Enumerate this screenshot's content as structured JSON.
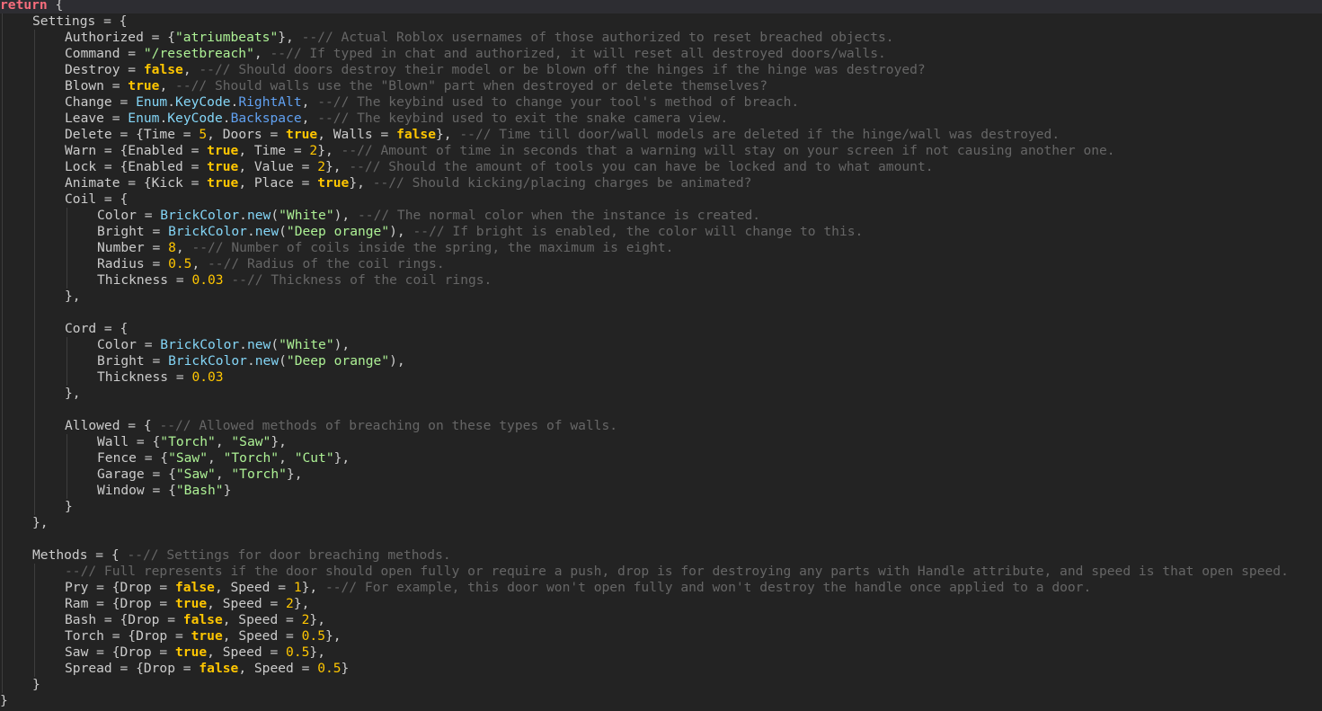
{
  "editor": {
    "colors": {
      "background": "#232323",
      "text": "#cccccc",
      "keyword": "#f86d7c",
      "string": "#adf195",
      "comment": "#666666",
      "number": "#ffc600",
      "builtin": "#84d6f7",
      "property": "#61a1f1",
      "current_line": "#2d2d32"
    },
    "lines": [
      {
        "indent": 0,
        "current": true,
        "tokens": [
          {
            "t": "return",
            "c": "kw-ret"
          },
          {
            "t": " {",
            "c": "id"
          }
        ]
      },
      {
        "indent": 1,
        "tokens": [
          {
            "t": "Settings = {",
            "c": "id"
          }
        ]
      },
      {
        "indent": 2,
        "tokens": [
          {
            "t": "Authorized = {",
            "c": "id"
          },
          {
            "t": "\"atriumbeats\"",
            "c": "str"
          },
          {
            "t": "}, ",
            "c": "id"
          },
          {
            "t": "--// Actual Roblox usernames of those authorized to reset breached objects.",
            "c": "cmt"
          }
        ]
      },
      {
        "indent": 2,
        "tokens": [
          {
            "t": "Command = ",
            "c": "id"
          },
          {
            "t": "\"/resetbreach\"",
            "c": "str"
          },
          {
            "t": ", ",
            "c": "id"
          },
          {
            "t": "--// If typed in chat and authorized, it will reset all destroyed doors/walls.",
            "c": "cmt"
          }
        ]
      },
      {
        "indent": 2,
        "tokens": [
          {
            "t": "Destroy = ",
            "c": "id"
          },
          {
            "t": "false",
            "c": "bool"
          },
          {
            "t": ", ",
            "c": "id"
          },
          {
            "t": "--// Should doors destroy their model or be blown off the hinges if the hinge was destroyed?",
            "c": "cmt"
          }
        ]
      },
      {
        "indent": 2,
        "tokens": [
          {
            "t": "Blown = ",
            "c": "id"
          },
          {
            "t": "true",
            "c": "bool"
          },
          {
            "t": ", ",
            "c": "id"
          },
          {
            "t": "--// Should walls use the \"Blown\" part when destroyed or delete themselves?",
            "c": "cmt"
          }
        ]
      },
      {
        "indent": 2,
        "tokens": [
          {
            "t": "Change = ",
            "c": "id"
          },
          {
            "t": "Enum",
            "c": "builtin"
          },
          {
            "t": ".",
            "c": "id"
          },
          {
            "t": "KeyCode",
            "c": "builtin"
          },
          {
            "t": ".",
            "c": "id"
          },
          {
            "t": "RightAlt",
            "c": "prop"
          },
          {
            "t": ", ",
            "c": "id"
          },
          {
            "t": "--// The keybind used to change your tool's method of breach.",
            "c": "cmt"
          }
        ]
      },
      {
        "indent": 2,
        "tokens": [
          {
            "t": "Leave = ",
            "c": "id"
          },
          {
            "t": "Enum",
            "c": "builtin"
          },
          {
            "t": ".",
            "c": "id"
          },
          {
            "t": "KeyCode",
            "c": "builtin"
          },
          {
            "t": ".",
            "c": "id"
          },
          {
            "t": "Backspace",
            "c": "prop"
          },
          {
            "t": ", ",
            "c": "id"
          },
          {
            "t": "--// The keybind used to exit the snake camera view.",
            "c": "cmt"
          }
        ]
      },
      {
        "indent": 2,
        "tokens": [
          {
            "t": "Delete = {Time = ",
            "c": "id"
          },
          {
            "t": "5",
            "c": "num"
          },
          {
            "t": ", Doors = ",
            "c": "id"
          },
          {
            "t": "true",
            "c": "bool"
          },
          {
            "t": ", Walls = ",
            "c": "id"
          },
          {
            "t": "false",
            "c": "bool"
          },
          {
            "t": "}, ",
            "c": "id"
          },
          {
            "t": "--// Time till door/wall models are deleted if the hinge/wall was destroyed.",
            "c": "cmt"
          }
        ]
      },
      {
        "indent": 2,
        "tokens": [
          {
            "t": "Warn = {Enabled = ",
            "c": "id"
          },
          {
            "t": "true",
            "c": "bool"
          },
          {
            "t": ", Time = ",
            "c": "id"
          },
          {
            "t": "2",
            "c": "num"
          },
          {
            "t": "}, ",
            "c": "id"
          },
          {
            "t": "--// Amount of time in seconds that a warning will stay on your screen if not causing another one.",
            "c": "cmt"
          }
        ]
      },
      {
        "indent": 2,
        "tokens": [
          {
            "t": "Lock = {Enabled = ",
            "c": "id"
          },
          {
            "t": "true",
            "c": "bool"
          },
          {
            "t": ", Value = ",
            "c": "id"
          },
          {
            "t": "2",
            "c": "num"
          },
          {
            "t": "}, ",
            "c": "id"
          },
          {
            "t": "--// Should the amount of tools you can have be locked and to what amount.",
            "c": "cmt"
          }
        ]
      },
      {
        "indent": 2,
        "tokens": [
          {
            "t": "Animate = {Kick = ",
            "c": "id"
          },
          {
            "t": "true",
            "c": "bool"
          },
          {
            "t": ", Place = ",
            "c": "id"
          },
          {
            "t": "true",
            "c": "bool"
          },
          {
            "t": "}, ",
            "c": "id"
          },
          {
            "t": "--// Should kicking/placing charges be animated?",
            "c": "cmt"
          }
        ]
      },
      {
        "indent": 2,
        "tokens": [
          {
            "t": "Coil = {",
            "c": "id"
          }
        ]
      },
      {
        "indent": 3,
        "tokens": [
          {
            "t": "Color = ",
            "c": "id"
          },
          {
            "t": "BrickColor",
            "c": "builtin"
          },
          {
            "t": ".",
            "c": "id"
          },
          {
            "t": "new",
            "c": "builtin"
          },
          {
            "t": "(",
            "c": "id"
          },
          {
            "t": "\"White\"",
            "c": "str"
          },
          {
            "t": "), ",
            "c": "id"
          },
          {
            "t": "--// The normal color when the instance is created.",
            "c": "cmt"
          }
        ]
      },
      {
        "indent": 3,
        "tokens": [
          {
            "t": "Bright = ",
            "c": "id"
          },
          {
            "t": "BrickColor",
            "c": "builtin"
          },
          {
            "t": ".",
            "c": "id"
          },
          {
            "t": "new",
            "c": "builtin"
          },
          {
            "t": "(",
            "c": "id"
          },
          {
            "t": "\"Deep orange\"",
            "c": "str"
          },
          {
            "t": "), ",
            "c": "id"
          },
          {
            "t": "--// If bright is enabled, the color will change to this.",
            "c": "cmt"
          }
        ]
      },
      {
        "indent": 3,
        "tokens": [
          {
            "t": "Number = ",
            "c": "id"
          },
          {
            "t": "8",
            "c": "num"
          },
          {
            "t": ", ",
            "c": "id"
          },
          {
            "t": "--// Number of coils inside the spring, the maximum is eight.",
            "c": "cmt"
          }
        ]
      },
      {
        "indent": 3,
        "tokens": [
          {
            "t": "Radius = ",
            "c": "id"
          },
          {
            "t": "0.5",
            "c": "num"
          },
          {
            "t": ", ",
            "c": "id"
          },
          {
            "t": "--// Radius of the coil rings.",
            "c": "cmt"
          }
        ]
      },
      {
        "indent": 3,
        "tokens": [
          {
            "t": "Thickness = ",
            "c": "id"
          },
          {
            "t": "0.03",
            "c": "num"
          },
          {
            "t": " ",
            "c": "id"
          },
          {
            "t": "--// Thickness of the coil rings.",
            "c": "cmt"
          }
        ]
      },
      {
        "indent": 2,
        "tokens": [
          {
            "t": "},",
            "c": "id"
          }
        ]
      },
      {
        "indent": 2,
        "tokens": []
      },
      {
        "indent": 2,
        "tokens": [
          {
            "t": "Cord = {",
            "c": "id"
          }
        ]
      },
      {
        "indent": 3,
        "tokens": [
          {
            "t": "Color = ",
            "c": "id"
          },
          {
            "t": "BrickColor",
            "c": "builtin"
          },
          {
            "t": ".",
            "c": "id"
          },
          {
            "t": "new",
            "c": "builtin"
          },
          {
            "t": "(",
            "c": "id"
          },
          {
            "t": "\"White\"",
            "c": "str"
          },
          {
            "t": "),",
            "c": "id"
          }
        ]
      },
      {
        "indent": 3,
        "tokens": [
          {
            "t": "Bright = ",
            "c": "id"
          },
          {
            "t": "BrickColor",
            "c": "builtin"
          },
          {
            "t": ".",
            "c": "id"
          },
          {
            "t": "new",
            "c": "builtin"
          },
          {
            "t": "(",
            "c": "id"
          },
          {
            "t": "\"Deep orange\"",
            "c": "str"
          },
          {
            "t": "),",
            "c": "id"
          }
        ]
      },
      {
        "indent": 3,
        "tokens": [
          {
            "t": "Thickness = ",
            "c": "id"
          },
          {
            "t": "0.03",
            "c": "num"
          }
        ]
      },
      {
        "indent": 2,
        "tokens": [
          {
            "t": "},",
            "c": "id"
          }
        ]
      },
      {
        "indent": 2,
        "tokens": []
      },
      {
        "indent": 2,
        "tokens": [
          {
            "t": "Allowed = { ",
            "c": "id"
          },
          {
            "t": "--// Allowed methods of breaching on these types of walls.",
            "c": "cmt"
          }
        ]
      },
      {
        "indent": 3,
        "tokens": [
          {
            "t": "Wall = {",
            "c": "id"
          },
          {
            "t": "\"Torch\"",
            "c": "str"
          },
          {
            "t": ", ",
            "c": "id"
          },
          {
            "t": "\"Saw\"",
            "c": "str"
          },
          {
            "t": "},",
            "c": "id"
          }
        ]
      },
      {
        "indent": 3,
        "tokens": [
          {
            "t": "Fence = {",
            "c": "id"
          },
          {
            "t": "\"Saw\"",
            "c": "str"
          },
          {
            "t": ", ",
            "c": "id"
          },
          {
            "t": "\"Torch\"",
            "c": "str"
          },
          {
            "t": ", ",
            "c": "id"
          },
          {
            "t": "\"Cut\"",
            "c": "str"
          },
          {
            "t": "},",
            "c": "id"
          }
        ]
      },
      {
        "indent": 3,
        "tokens": [
          {
            "t": "Garage = {",
            "c": "id"
          },
          {
            "t": "\"Saw\"",
            "c": "str"
          },
          {
            "t": ", ",
            "c": "id"
          },
          {
            "t": "\"Torch\"",
            "c": "str"
          },
          {
            "t": "},",
            "c": "id"
          }
        ]
      },
      {
        "indent": 3,
        "tokens": [
          {
            "t": "Window = {",
            "c": "id"
          },
          {
            "t": "\"Bash\"",
            "c": "str"
          },
          {
            "t": "}",
            "c": "id"
          }
        ]
      },
      {
        "indent": 2,
        "tokens": [
          {
            "t": "}",
            "c": "id"
          }
        ]
      },
      {
        "indent": 1,
        "tokens": [
          {
            "t": "},",
            "c": "id"
          }
        ]
      },
      {
        "indent": 1,
        "tokens": []
      },
      {
        "indent": 1,
        "tokens": [
          {
            "t": "Methods = { ",
            "c": "id"
          },
          {
            "t": "--// Settings for door breaching methods.",
            "c": "cmt"
          }
        ]
      },
      {
        "indent": 2,
        "tokens": [
          {
            "t": "--// Full represents if the door should open fully or require a push, drop is for destroying any parts with Handle attribute, and speed is that open speed.",
            "c": "cmt"
          }
        ]
      },
      {
        "indent": 2,
        "tokens": [
          {
            "t": "Pry = {Drop = ",
            "c": "id"
          },
          {
            "t": "false",
            "c": "bool"
          },
          {
            "t": ", Speed = ",
            "c": "id"
          },
          {
            "t": "1",
            "c": "num"
          },
          {
            "t": "}, ",
            "c": "id"
          },
          {
            "t": "--// For example, this door won't open fully and won't destroy the handle once applied to a door.",
            "c": "cmt"
          }
        ]
      },
      {
        "indent": 2,
        "tokens": [
          {
            "t": "Ram = {Drop = ",
            "c": "id"
          },
          {
            "t": "true",
            "c": "bool"
          },
          {
            "t": ", Speed = ",
            "c": "id"
          },
          {
            "t": "2",
            "c": "num"
          },
          {
            "t": "},",
            "c": "id"
          }
        ]
      },
      {
        "indent": 2,
        "tokens": [
          {
            "t": "Bash = {Drop = ",
            "c": "id"
          },
          {
            "t": "false",
            "c": "bool"
          },
          {
            "t": ", Speed = ",
            "c": "id"
          },
          {
            "t": "2",
            "c": "num"
          },
          {
            "t": "},",
            "c": "id"
          }
        ]
      },
      {
        "indent": 2,
        "tokens": [
          {
            "t": "Torch = {Drop = ",
            "c": "id"
          },
          {
            "t": "true",
            "c": "bool"
          },
          {
            "t": ", Speed = ",
            "c": "id"
          },
          {
            "t": "0.5",
            "c": "num"
          },
          {
            "t": "},",
            "c": "id"
          }
        ]
      },
      {
        "indent": 2,
        "tokens": [
          {
            "t": "Saw = {Drop = ",
            "c": "id"
          },
          {
            "t": "true",
            "c": "bool"
          },
          {
            "t": ", Speed = ",
            "c": "id"
          },
          {
            "t": "0.5",
            "c": "num"
          },
          {
            "t": "},",
            "c": "id"
          }
        ]
      },
      {
        "indent": 2,
        "tokens": [
          {
            "t": "Spread = {Drop = ",
            "c": "id"
          },
          {
            "t": "false",
            "c": "bool"
          },
          {
            "t": ", Speed = ",
            "c": "id"
          },
          {
            "t": "0.5",
            "c": "num"
          },
          {
            "t": "}",
            "c": "id"
          }
        ]
      },
      {
        "indent": 1,
        "tokens": [
          {
            "t": "}",
            "c": "id"
          }
        ]
      },
      {
        "indent": 0,
        "tokens": [
          {
            "t": "}",
            "c": "id"
          }
        ]
      }
    ]
  }
}
